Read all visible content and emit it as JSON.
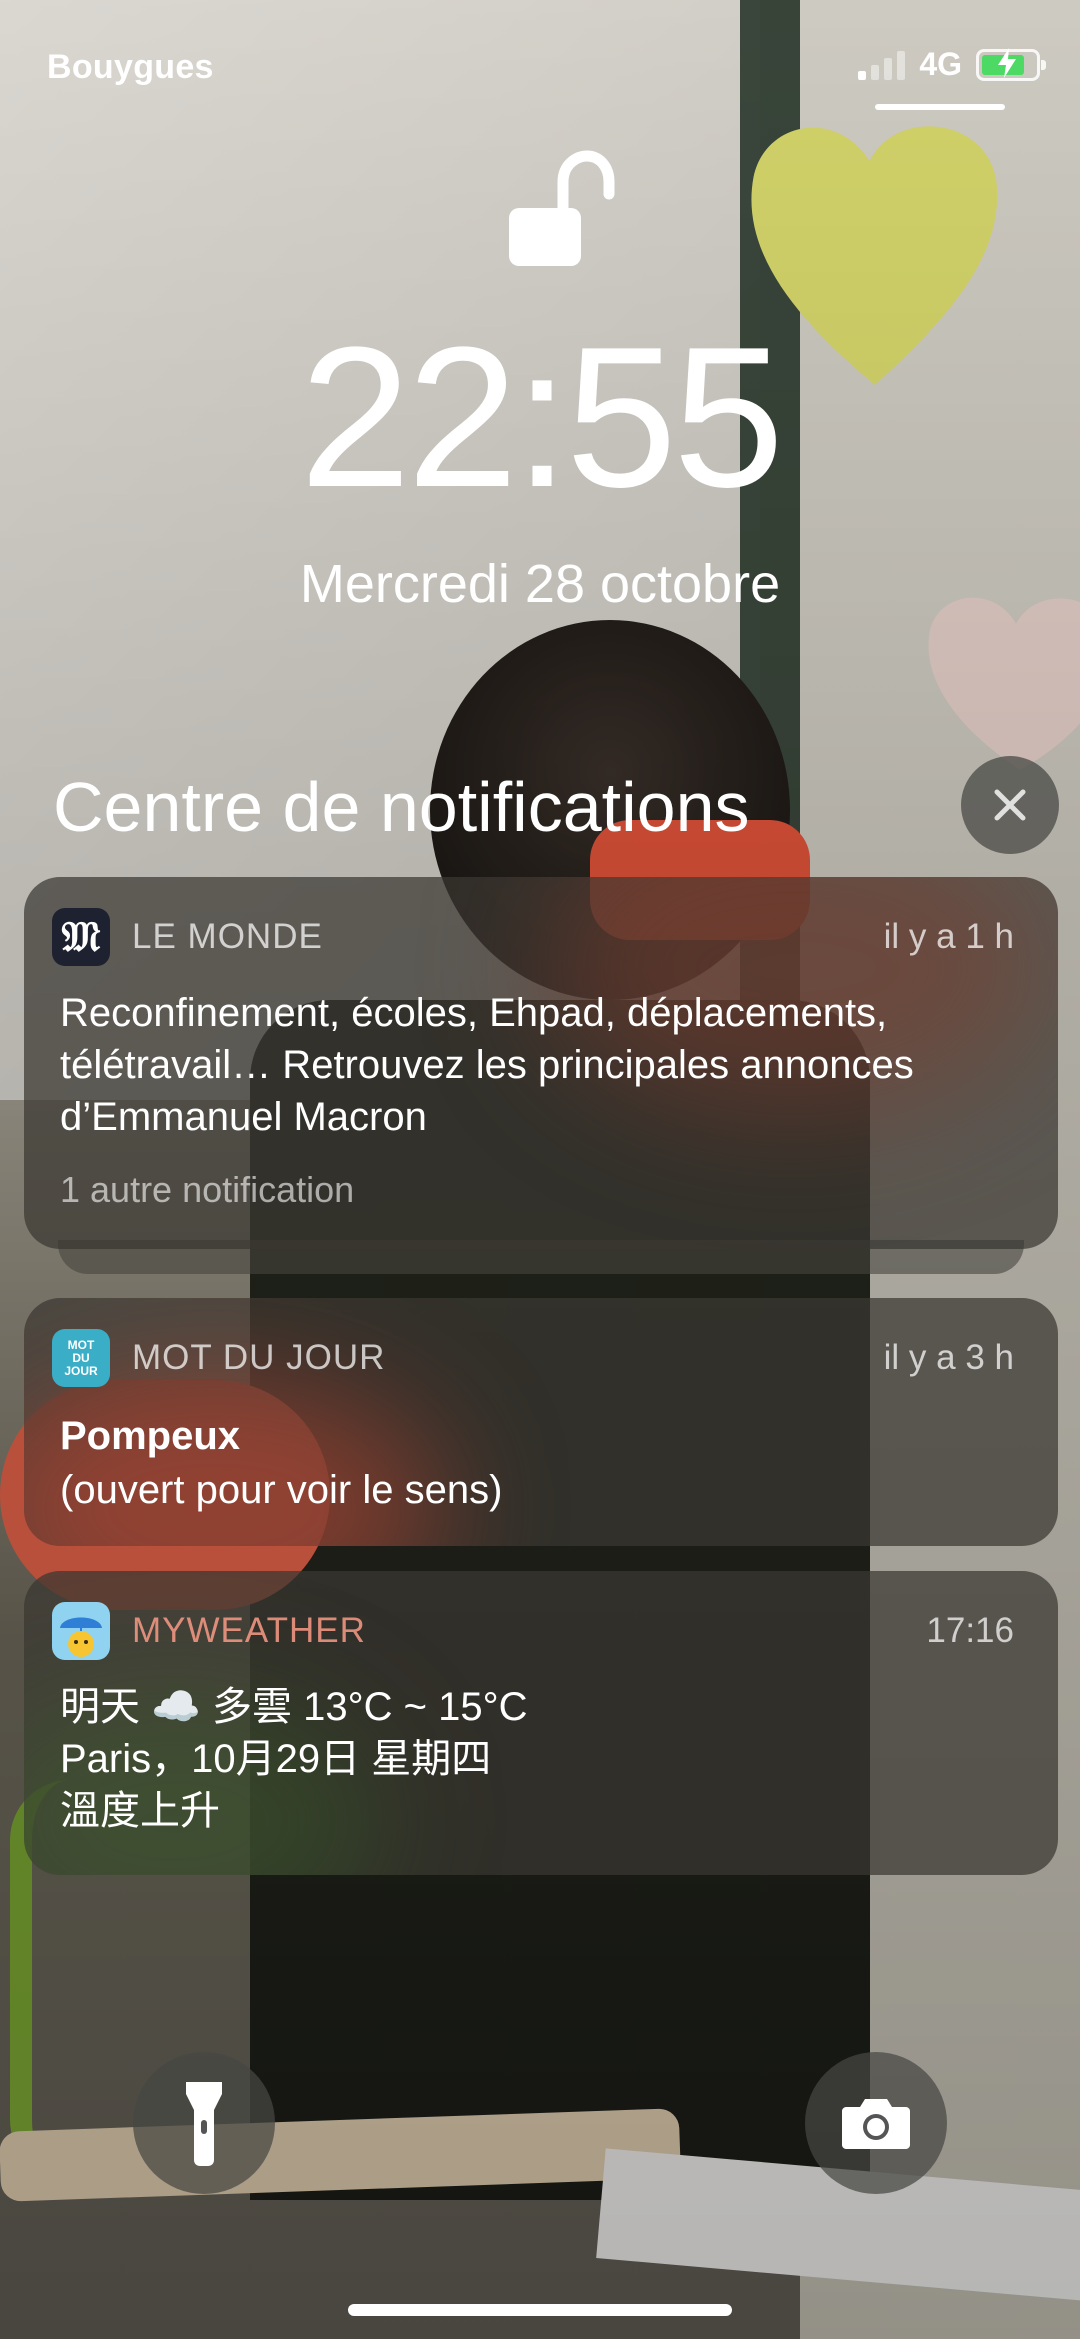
{
  "status_bar": {
    "carrier": "Bouygues",
    "network": "4G",
    "signal_bars": 1,
    "battery_charging": true
  },
  "lock_screen": {
    "lock_state": "unlocked",
    "time": "22:55",
    "date": "Mercredi 28 octobre"
  },
  "notification_center": {
    "title": "Centre de notifications",
    "close_icon": "close-icon"
  },
  "notifications": [
    {
      "app": "LE MONDE",
      "icon": "le-monde-icon",
      "icon_glyph": "𝔐",
      "time": "il y a 1 h",
      "body": "Reconfinement, écoles, Ehpad, déplacements, télétravail… Retrouvez les principales annonces d’Emmanuel Macron",
      "more": "1 autre notification"
    },
    {
      "app": "MOT DU JOUR",
      "icon": "mot-du-jour-icon",
      "icon_text": "MOT DU JOUR",
      "time": "il y a 3 h",
      "title": "Pompeux",
      "body": "(ouvert pour voir le sens)"
    },
    {
      "app": "MYWEATHER",
      "icon": "myweather-icon",
      "time": "17:16",
      "line1": "明天 ☁️ 多雲 13°C ~ 15°C",
      "line2": "Paris，10月29日 星期四",
      "line3": "溫度上升"
    }
  ],
  "quick_actions": {
    "left": "flashlight-icon",
    "right": "camera-icon"
  },
  "colors": {
    "notification_bg": "#3a3832",
    "battery_green": "#4cd964",
    "le_monde_bg": "#1e2230",
    "mot_du_jour_bg": "#3aaec7",
    "myweather_bg": "#8fd3f0"
  }
}
